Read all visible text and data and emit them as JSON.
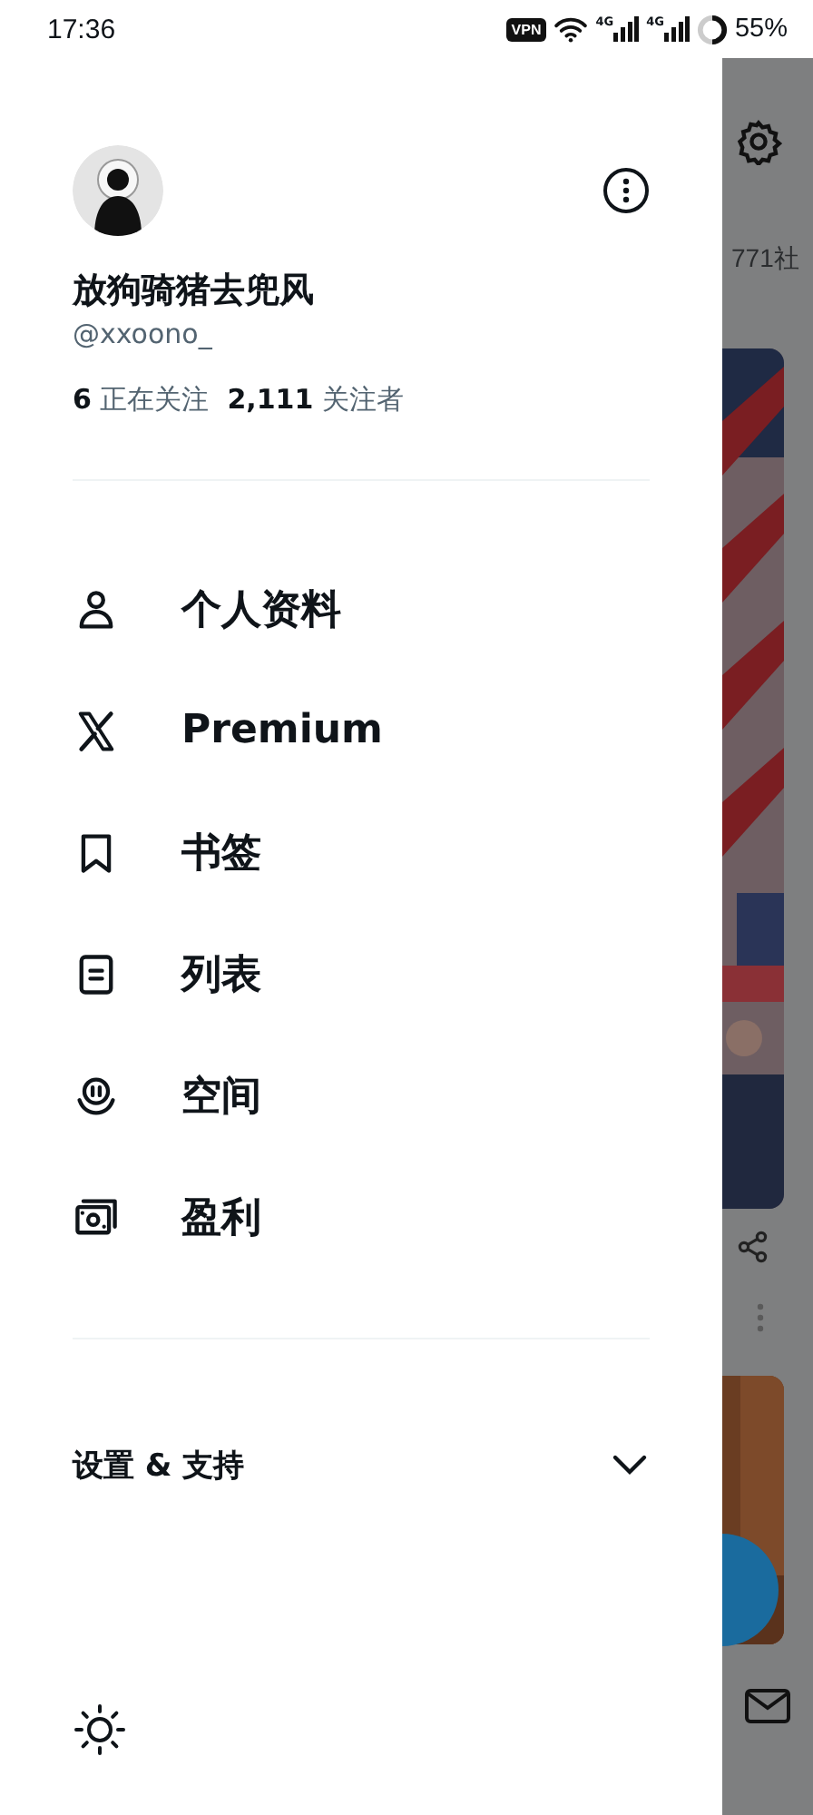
{
  "status_bar": {
    "time": "17:36",
    "vpn": "VPN",
    "networks": [
      "4G",
      "4G"
    ],
    "battery": "55%"
  },
  "profile": {
    "name": "放狗骑猪去兜风",
    "handle": "@xxoono_",
    "following_count": "6",
    "following_label": "正在关注",
    "followers_count": "2,111",
    "followers_label": "关注者"
  },
  "menu": [
    {
      "kind": "profile",
      "label": "个人资料"
    },
    {
      "kind": "premium",
      "label": "Premium"
    },
    {
      "kind": "bookmarks",
      "label": "书签"
    },
    {
      "kind": "lists",
      "label": "列表"
    },
    {
      "kind": "spaces",
      "label": "空间"
    },
    {
      "kind": "monetization",
      "label": "盈利"
    }
  ],
  "settings_section": {
    "label": "设置 & 支持",
    "expanded": false
  },
  "background": {
    "header_text": "771社"
  }
}
